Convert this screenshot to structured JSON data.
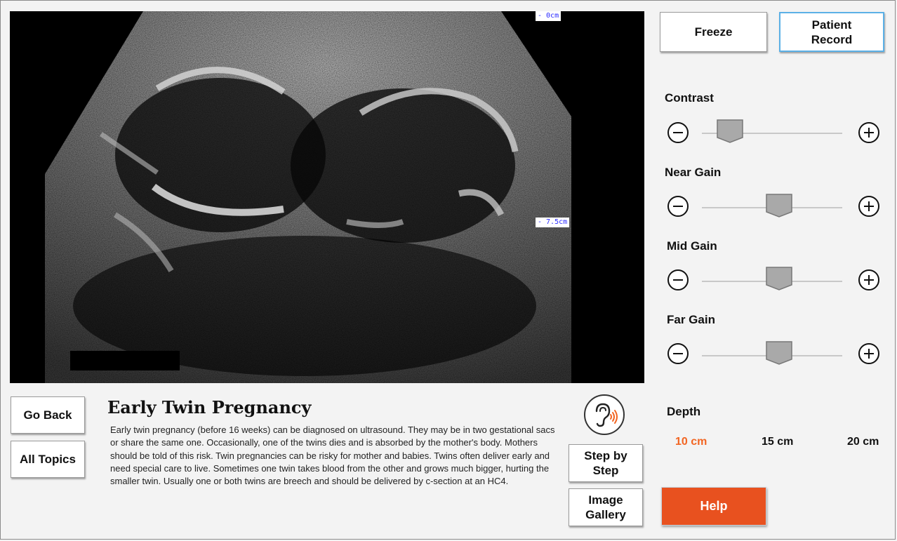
{
  "viewport": {
    "depth_top": "- 0cm",
    "depth_mid": "- 7.5cm"
  },
  "toolbar": {
    "freeze": "Freeze",
    "patient_record": "Patient Record"
  },
  "controls": [
    {
      "label": "Contrast",
      "level": 0.2
    },
    {
      "label": "Near Gain",
      "level": 0.55
    },
    {
      "label": "Mid Gain",
      "level": 0.55
    },
    {
      "label": "Far Gain",
      "level": 0.55
    }
  ],
  "nav": {
    "go_back": "Go Back",
    "all_topics": "All Topics"
  },
  "topic": {
    "title": "Early Twin Pregnancy",
    "description": "Early twin pregnancy (before 16 weeks) can be diagnosed on ultrasound. They may be in two gestational sacs or share the same one.  Occasionally, one of the twins dies and is absorbed by the mother's body. Mothers should be told of this risk. Twin pregnancies can be risky for mother and babies. Twins often deliver early and need special care to live. Sometimes one twin takes blood from the other and grows much bigger, hurting the smaller twin. Usually one or both twins are breech and should be delivered by c-section at an HC4."
  },
  "actions": {
    "step_by_step": "Step by Step",
    "image_gallery": "Image Gallery",
    "help": "Help"
  },
  "depth": {
    "title": "Depth",
    "options": [
      "10 cm",
      "15 cm",
      "20 cm"
    ],
    "selected": "10 cm"
  },
  "colors": {
    "accent": "#e8511f",
    "selected_depth": "#f26522",
    "record_border": "#5bb0e6"
  },
  "icons": {
    "audio": "ear-audio-icon",
    "minus": "minus-circle-icon",
    "plus": "plus-circle-icon"
  }
}
